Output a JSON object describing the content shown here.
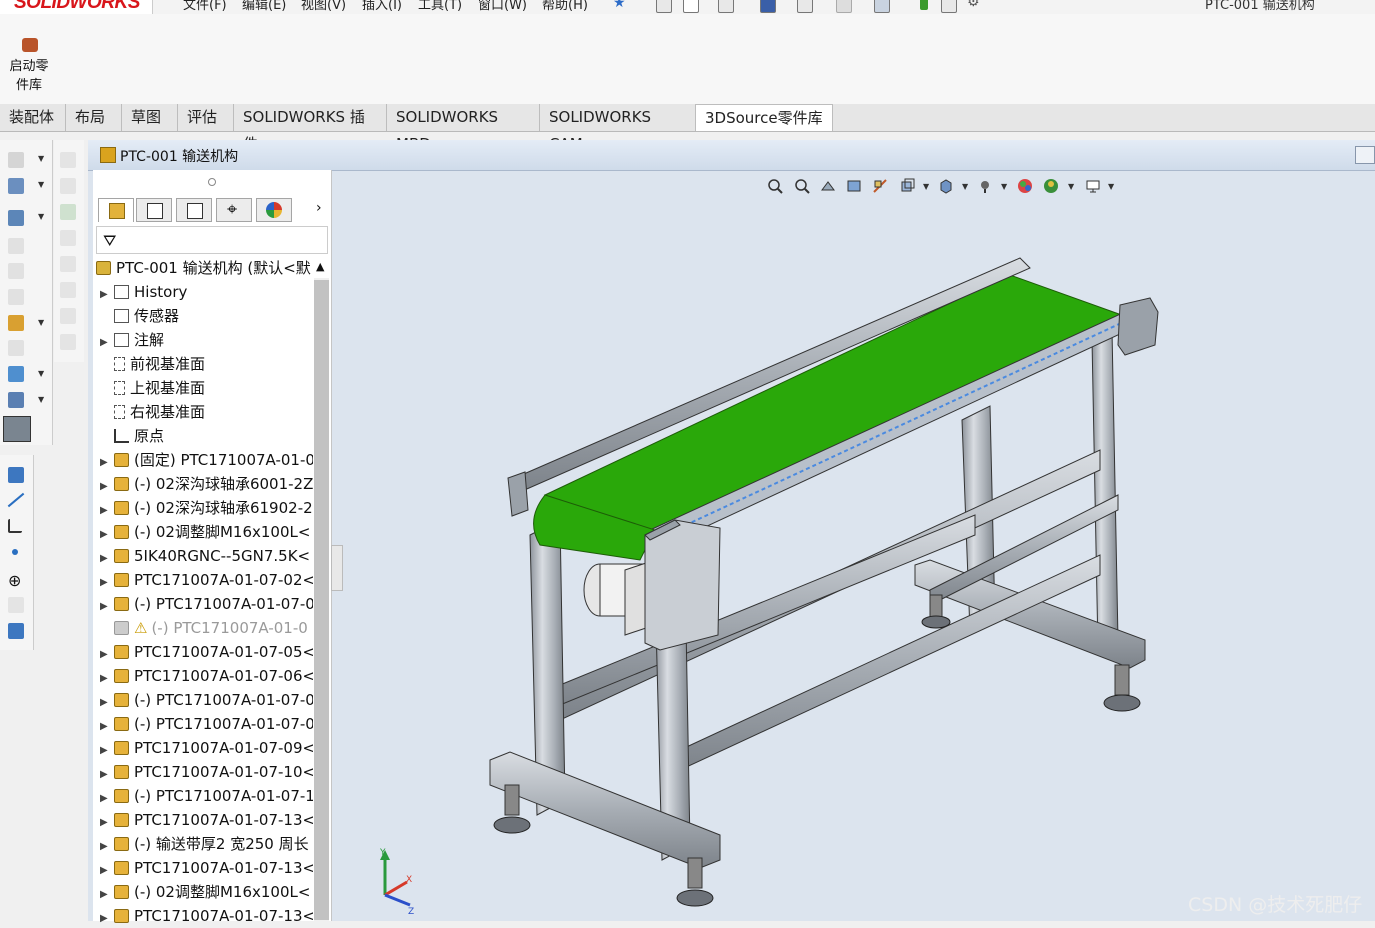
{
  "app": {
    "logo": "SOLIDWORKS",
    "window_title": "PTC-001 输送机构",
    "menu": [
      "文件(F)",
      "编辑(E)",
      "视图(V)",
      "插入(I)",
      "工具(T)",
      "窗口(W)",
      "帮助(H)"
    ]
  },
  "ribbon": {
    "launch_button": "启动零件库"
  },
  "tabs": [
    {
      "label": "装配体"
    },
    {
      "label": "布局"
    },
    {
      "label": "草图"
    },
    {
      "label": "评估"
    },
    {
      "label": "SOLIDWORKS 插件"
    },
    {
      "label": "SOLIDWORKS MBD"
    },
    {
      "label": "SOLIDWORKS CAM"
    },
    {
      "label": "3DSource零件库",
      "active": true
    }
  ],
  "document": {
    "title": "PTC-001 输送机构"
  },
  "feature_tree": {
    "root": "PTC-001 输送机构 (默认<默",
    "items": [
      {
        "label": "History",
        "icon": "history-icon",
        "expandable": true
      },
      {
        "label": "传感器",
        "icon": "sensor-icon",
        "expandable": false
      },
      {
        "label": "注解",
        "icon": "annotation-icon",
        "expandable": true
      },
      {
        "label": "前视基准面",
        "icon": "plane-icon",
        "expandable": false
      },
      {
        "label": "上视基准面",
        "icon": "plane-icon",
        "expandable": false
      },
      {
        "label": "右视基准面",
        "icon": "plane-icon",
        "expandable": false
      },
      {
        "label": "原点",
        "icon": "origin-icon",
        "expandable": false
      },
      {
        "label": "(固定) PTC171007A-01-0",
        "icon": "part-icon",
        "expandable": true
      },
      {
        "label": "(-) 02深沟球轴承6001-2Z",
        "icon": "part-icon",
        "expandable": true
      },
      {
        "label": "(-) 02深沟球轴承61902-2",
        "icon": "part-icon",
        "expandable": true
      },
      {
        "label": "(-) 02调整脚M16x100L<",
        "icon": "part-icon",
        "expandable": true
      },
      {
        "label": "5IK40RGNC--5GN7.5K<",
        "icon": "part-icon",
        "expandable": true
      },
      {
        "label": "PTC171007A-01-07-02<",
        "icon": "part-icon",
        "expandable": true
      },
      {
        "label": "(-) PTC171007A-01-07-0",
        "icon": "part-icon",
        "expandable": true
      },
      {
        "label": "(-) PTC171007A-01-0",
        "icon": "part-icon",
        "expandable": false,
        "warning": true,
        "dim": true
      },
      {
        "label": "PTC171007A-01-07-05<",
        "icon": "part-icon",
        "expandable": true
      },
      {
        "label": "PTC171007A-01-07-06<",
        "icon": "part-icon",
        "expandable": true
      },
      {
        "label": "(-) PTC171007A-01-07-0",
        "icon": "part-icon",
        "expandable": true
      },
      {
        "label": "(-) PTC171007A-01-07-0",
        "icon": "part-icon",
        "expandable": true
      },
      {
        "label": "PTC171007A-01-07-09<",
        "icon": "part-icon",
        "expandable": true
      },
      {
        "label": "PTC171007A-01-07-10<",
        "icon": "part-icon",
        "expandable": true
      },
      {
        "label": "(-) PTC171007A-01-07-1",
        "icon": "part-icon",
        "expandable": true
      },
      {
        "label": "PTC171007A-01-07-13<",
        "icon": "part-icon",
        "expandable": true
      },
      {
        "label": "(-) 输送带厚2 宽250 周长",
        "icon": "part-icon",
        "expandable": true
      },
      {
        "label": "PTC171007A-01-07-13<",
        "icon": "part-icon",
        "expandable": true
      },
      {
        "label": "(-) 02调整脚M16x100L<",
        "icon": "part-icon",
        "expandable": true
      },
      {
        "label": "PTC171007A-01-07-13<",
        "icon": "part-icon",
        "expandable": true
      }
    ]
  },
  "watermark": "CSDN @技术死肥仔",
  "colors": {
    "belt": "#2aa80a",
    "frame": "#b9bec5",
    "viewport_bg": "#dce4ee",
    "logo_red": "#d8161b"
  }
}
